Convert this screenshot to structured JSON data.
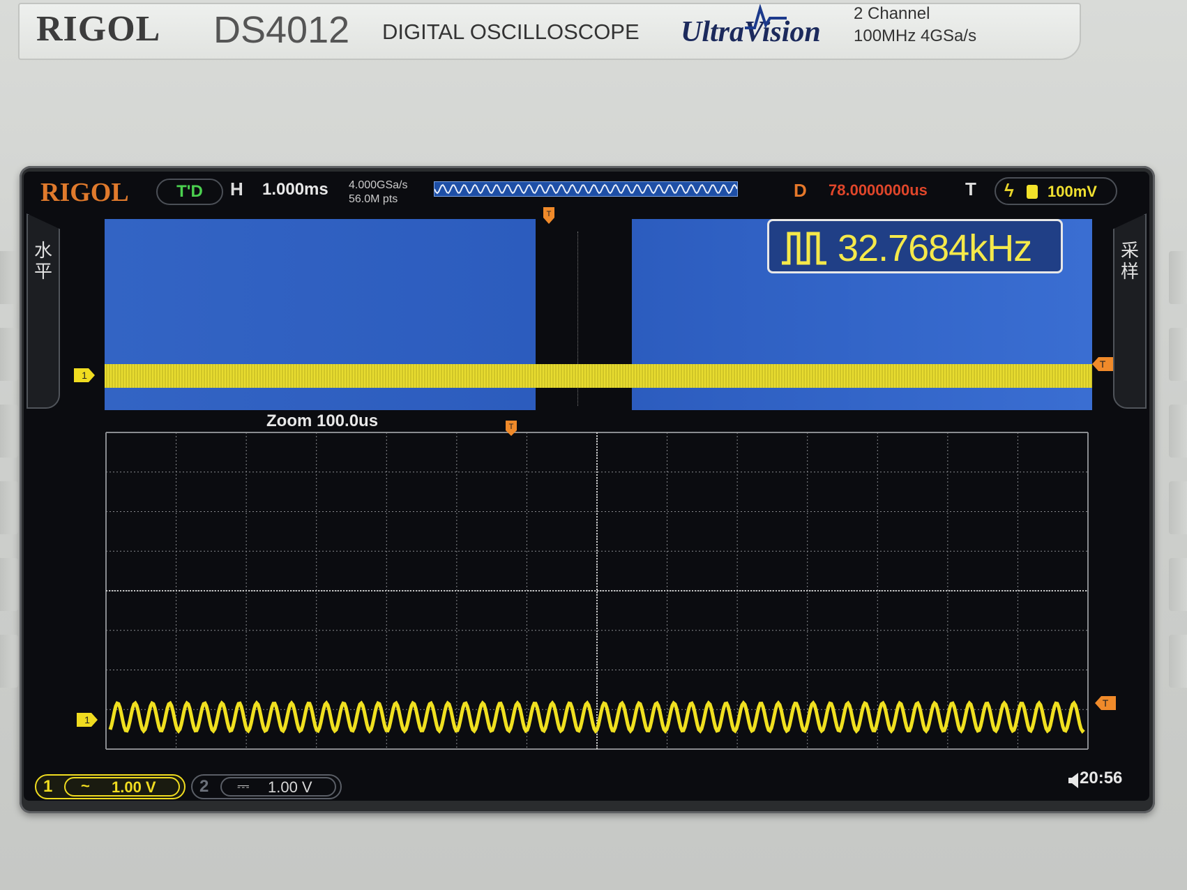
{
  "panel": {
    "brand": "RIGOL",
    "model": "DS4012",
    "description": "DIGITAL OSCILLOSCOPE",
    "series_logo": "UltraVision",
    "channels": "2 Channel",
    "spec": "100MHz  4GSa/s"
  },
  "screen": {
    "logo": "RIGOL",
    "mode": "T'D",
    "horizontal_label": "H",
    "timebase": "1.000ms",
    "sample_rate": "4.000GSa/s",
    "memory_depth": "56.0M pts",
    "delay_label": "D",
    "delay_value": "78.0000000us",
    "trigger_label": "T",
    "trigger_level": "100mV",
    "left_side_label": "水平",
    "right_side_label": "采样",
    "frequency": "32.7684kHz",
    "zoom_label": "Zoom  100.0us",
    "ch1_marker": "1",
    "trigger_marker": "T",
    "ch1": {
      "number": "1",
      "coupling": "~",
      "scale": "1.00 V"
    },
    "ch2": {
      "number": "2",
      "coupling": "⎓",
      "scale": "1.00 V"
    },
    "clock": "20:56"
  },
  "colors": {
    "ch1": "#f0dc20",
    "trigger": "#f08a2a",
    "logo": "#e07a2c",
    "delay": "#e0462a",
    "mode": "#4bd04f"
  },
  "icons": {
    "frequency": "square-pulse-icon",
    "trigger_type": "edge-trigger-icon",
    "speaker": "speaker-icon"
  }
}
